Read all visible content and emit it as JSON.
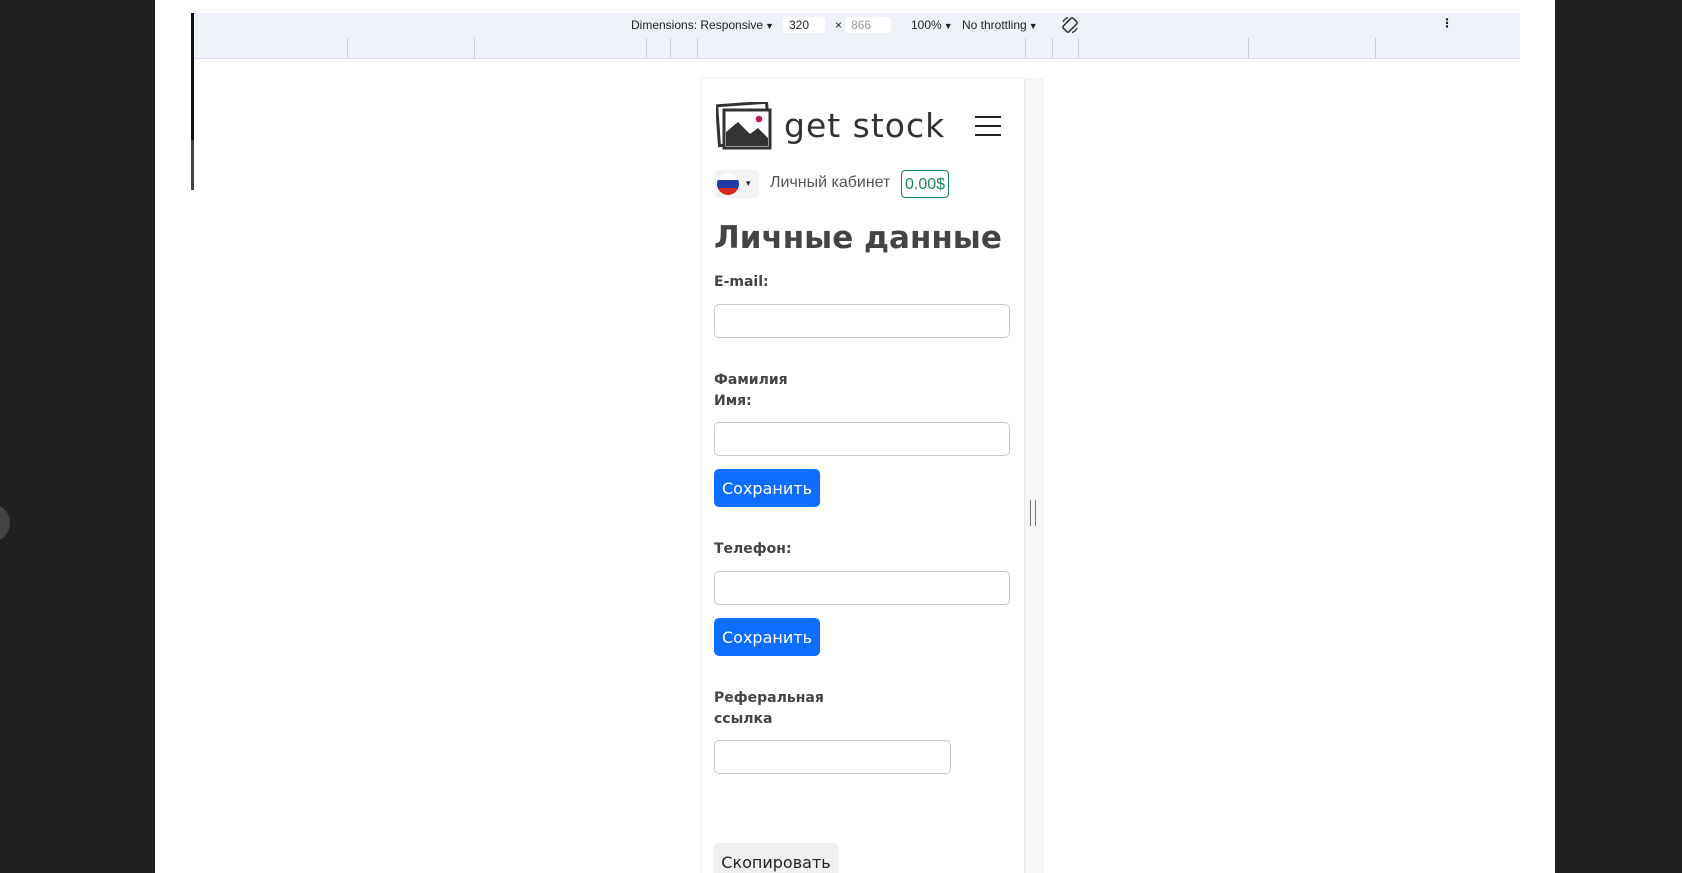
{
  "devtools": {
    "dimensions_label": "Dimensions: Responsive",
    "width_value": "320",
    "times": "×",
    "height_value": "866",
    "zoom": "100%",
    "throttling": "No throttling",
    "rotate_icon": "rotate-icon",
    "more_icon": "more-vertical-icon",
    "caret": "▼",
    "more": "⋮"
  },
  "header": {
    "brand": "get stock",
    "logo_icon": "photo-stack-icon",
    "menu_icon": "hamburger-icon"
  },
  "topbar": {
    "language_flag": "russia-flag-icon",
    "caret": "▾",
    "cabinet_link": "Личный кабинет",
    "balance": "0.00$"
  },
  "page": {
    "title": "Личные данные"
  },
  "form": {
    "email_label": "E-mail:",
    "email_value": "",
    "name_label": "Фамилия Имя:",
    "name_value": "",
    "save_label_1": "Сохранить",
    "phone_label": "Телефон:",
    "phone_value": "",
    "save_label_2": "Сохранить",
    "referral_label": "Реферальная ссылка",
    "referral_value": "",
    "copy_label": "Скопировать"
  },
  "colors": {
    "primary": "#0d6efd",
    "success": "#198754",
    "text": "#444444"
  }
}
